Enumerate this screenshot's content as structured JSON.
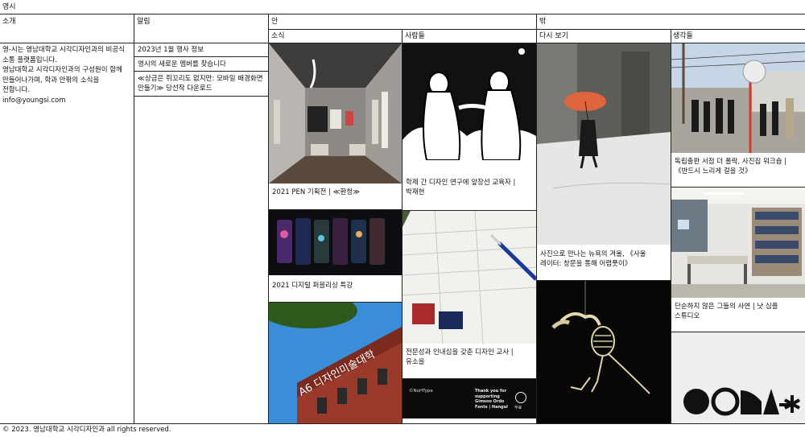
{
  "site": {
    "title": "영시"
  },
  "columns": {
    "intro": "소개",
    "notice": "알림",
    "inside": "안",
    "outside": "밖",
    "news": "소식",
    "people": "사람들",
    "revisit": "다시 보기",
    "thoughts": "생각들"
  },
  "intro": {
    "line1": "영-시는 영남대학교 시각디자인과의 비공식",
    "line2": "소통 플랫폼입니다.",
    "line3": "영남대학교 시각디자인과의 구성원이 함께",
    "line4": "만들어나가며, 학과 안팎의 소식을",
    "line5": "전합니다.",
    "email": "info@youngsi.com"
  },
  "notices": [
    {
      "text": "2023년 1월 행사 정보"
    },
    {
      "text": "영시의 새로운 멤버를 찾습니다"
    },
    {
      "line1": "≪상금은 쥐꼬리도 없지만: 모바일 배경화면",
      "line2": "만들기≫ 당선작 다운로드"
    }
  ],
  "news": [
    {
      "title": "2021 PEN 기획전 | ≪환청≫"
    },
    {
      "title": "2021 디지털 퍼블리싱 특강"
    }
  ],
  "news_image": {
    "sign_text": "A6 디자인미술대학"
  },
  "people": [
    {
      "line1": "학제 간 디자인 연구에 앞장선 교육자 |",
      "line2": "박재현"
    },
    {
      "line1": "전문성과 인내심을 갖춘 디자인 교사 |",
      "line2": "유소을"
    }
  ],
  "people_poster": {
    "left_text": "©NoHType",
    "right_line1": "Thank you for",
    "right_line2": "supporting",
    "right_line3": "Gimsoo Ordo",
    "right_line4": "Fonts | Hangul",
    "badge": "무료"
  },
  "revisit": [
    {
      "line1": "사진으로 만나는 뉴욕의 겨울, 《사울",
      "line2": "레이터: 창문을 통해 어렴풋이》"
    }
  ],
  "thoughts": [
    {
      "line1": "독립출판 서점 더 폴락, 사진집 워크숍 |",
      "line2": "《반드시 느리게 걸을 것》"
    },
    {
      "line1": "단순하지 않은 그들의 사연 | 낫 심플",
      "line2": "스튜디오"
    }
  ],
  "footer": {
    "copyright": "© 2023. 영남대학교 시각디자인과 all rights reserved."
  },
  "colors": {
    "line": "#222222",
    "background": "#ffffff",
    "umbrella": "#e0643c",
    "lamp": "#d23a2a"
  }
}
